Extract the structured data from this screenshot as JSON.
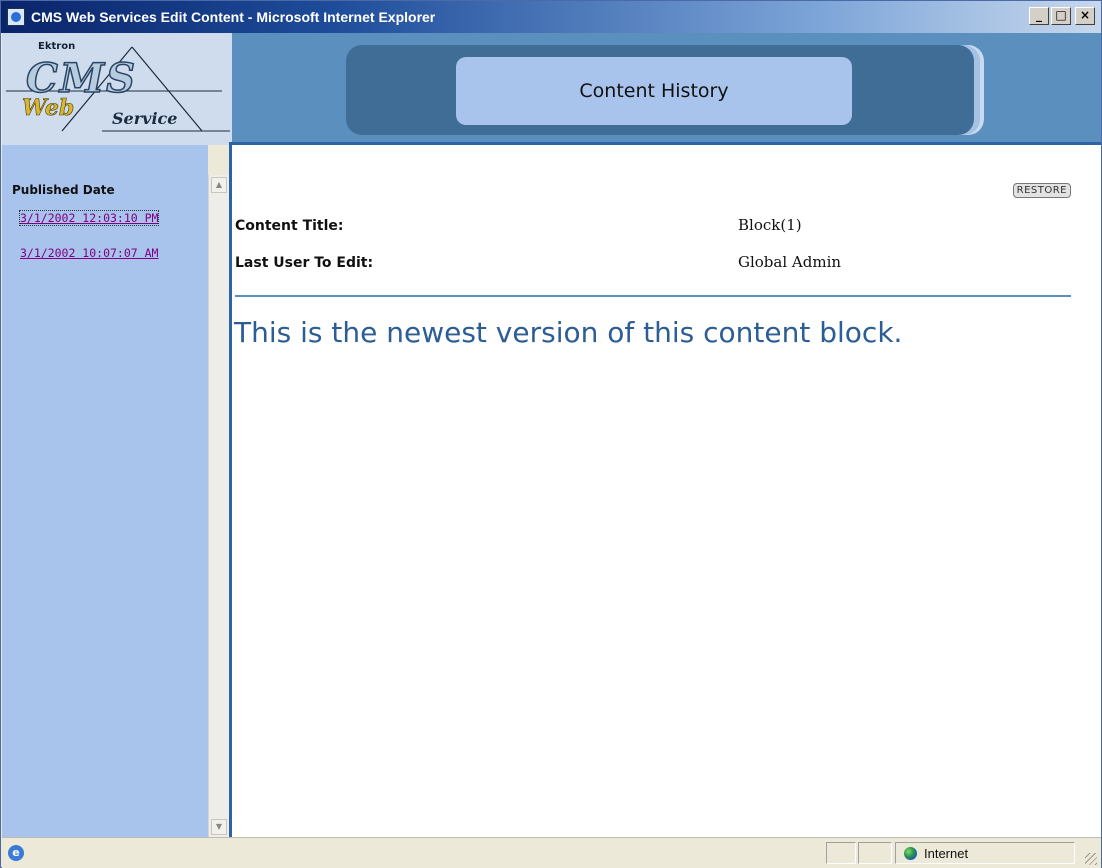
{
  "window": {
    "title": "CMS Web Services Edit Content - Microsoft Internet Explorer",
    "minimize_label": "_",
    "maximize_label": "□",
    "close_label": "×"
  },
  "logo": {
    "vendor": "Ektron",
    "product_line1": "CMS",
    "product_line2": "Web",
    "product_line3": "Service"
  },
  "header": {
    "title": "Content History"
  },
  "sidebar": {
    "heading": "Published Date",
    "items": [
      {
        "label": "3/1/2002 12:03:10 PM",
        "active": true
      },
      {
        "label": "3/1/2002 10:07:07 AM",
        "active": false
      }
    ]
  },
  "main": {
    "restore_label": "RESTORE",
    "fields": [
      {
        "label": "Content Title:",
        "value": "Block(1)"
      },
      {
        "label": "Last User To Edit:",
        "value": "Global Admin"
      }
    ],
    "notice": "This is the newest version of this content block."
  },
  "statusbar": {
    "ie_icon_glyph": "e",
    "zone": "Internet"
  },
  "colors": {
    "header_blue": "#5b8fbd",
    "sidebar_blue": "#a9c4ec",
    "notice_text": "#2c5d94",
    "visited_link": "#800080"
  },
  "icons": {
    "window_icon": "ie-page-icon",
    "zone_icon": "globe-icon"
  }
}
